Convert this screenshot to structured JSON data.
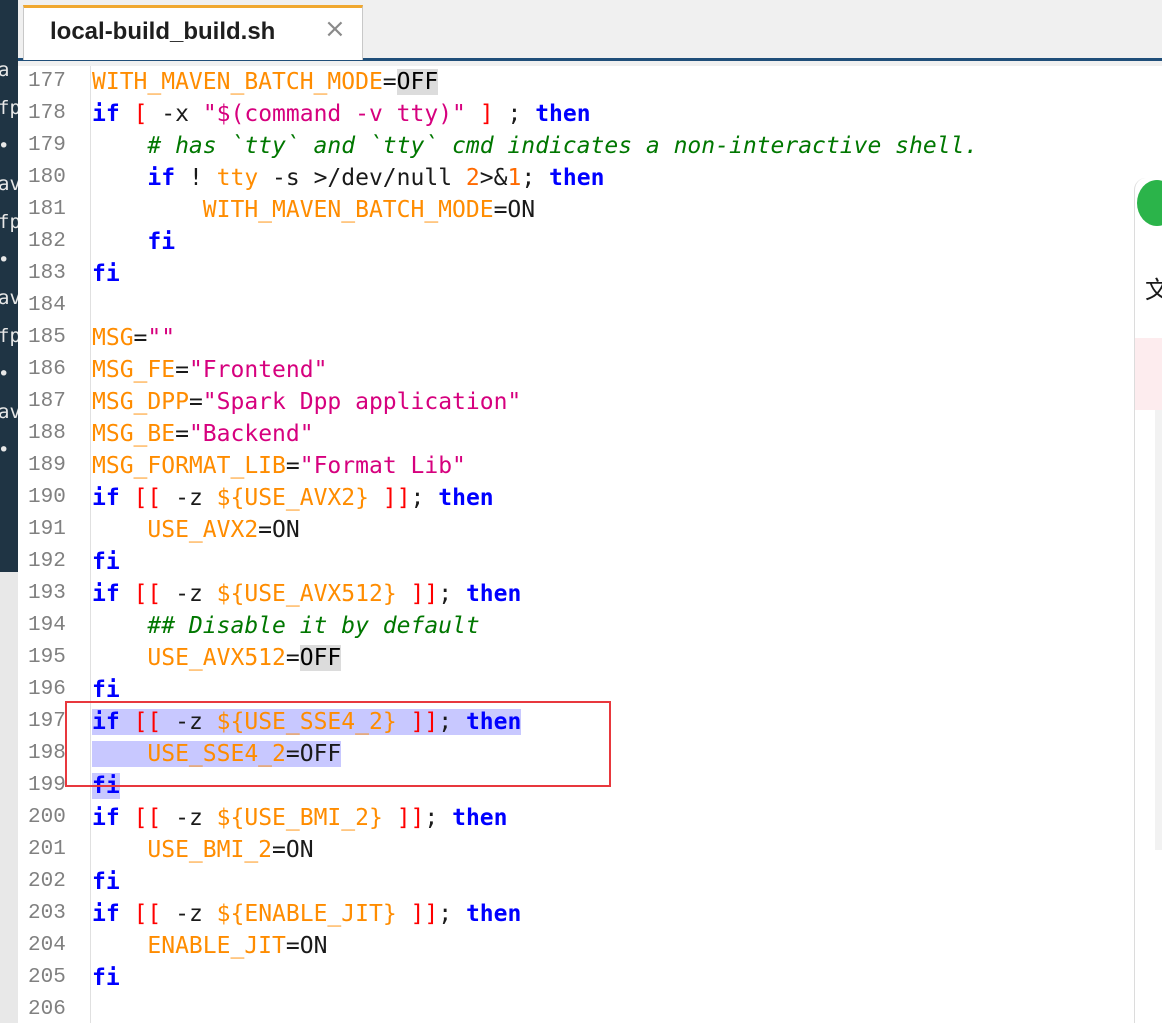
{
  "tab": {
    "title": "local-build_build.sh",
    "close_glyph": "×"
  },
  "left_terminal": [
    "a",
    "fp",
    "•",
    "av",
    "fp",
    "•",
    "av",
    "fp",
    "•",
    "av",
    "•"
  ],
  "right_panel": {
    "char": "文"
  },
  "lines": [
    {
      "n": "177",
      "parts": [
        [
          "var",
          "WITH_MAVEN_BATCH_MODE"
        ],
        [
          "op",
          "="
        ],
        [
          "sel",
          "OFF"
        ]
      ]
    },
    {
      "n": "178",
      "parts": [
        [
          "kw",
          "if"
        ],
        [
          "tx",
          " "
        ],
        [
          "brk",
          "["
        ],
        [
          "tx",
          " -x "
        ],
        [
          "str",
          "\"$(command -v tty)\""
        ],
        [
          "tx",
          " "
        ],
        [
          "brk",
          "]"
        ],
        [
          "tx",
          " ; "
        ],
        [
          "kw",
          "then"
        ]
      ]
    },
    {
      "n": "179",
      "parts": [
        [
          "tx",
          "    "
        ],
        [
          "cmt",
          "# has `tty` and `tty` cmd indicates a non-interactive shell."
        ]
      ]
    },
    {
      "n": "180",
      "parts": [
        [
          "tx",
          "    "
        ],
        [
          "kw",
          "if"
        ],
        [
          "tx",
          " ! "
        ],
        [
          "var",
          "tty"
        ],
        [
          "tx",
          " -s >/dev/null "
        ],
        [
          "num",
          "2"
        ],
        [
          "tx",
          ">&"
        ],
        [
          "num",
          "1"
        ],
        [
          "tx",
          "; "
        ],
        [
          "kw",
          "then"
        ]
      ]
    },
    {
      "n": "181",
      "parts": [
        [
          "tx",
          "        "
        ],
        [
          "var",
          "WITH_MAVEN_BATCH_MODE"
        ],
        [
          "op",
          "=ON"
        ]
      ]
    },
    {
      "n": "182",
      "parts": [
        [
          "tx",
          "    "
        ],
        [
          "kw",
          "fi"
        ]
      ]
    },
    {
      "n": "183",
      "parts": [
        [
          "kw",
          "fi"
        ]
      ]
    },
    {
      "n": "184",
      "parts": []
    },
    {
      "n": "185",
      "parts": [
        [
          "var",
          "MSG"
        ],
        [
          "op",
          "="
        ],
        [
          "str",
          "\"\""
        ]
      ]
    },
    {
      "n": "186",
      "parts": [
        [
          "var",
          "MSG_FE"
        ],
        [
          "op",
          "="
        ],
        [
          "str",
          "\"Frontend\""
        ]
      ]
    },
    {
      "n": "187",
      "parts": [
        [
          "var",
          "MSG_DPP"
        ],
        [
          "op",
          "="
        ],
        [
          "str",
          "\"Spark Dpp application\""
        ]
      ]
    },
    {
      "n": "188",
      "parts": [
        [
          "var",
          "MSG_BE"
        ],
        [
          "op",
          "="
        ],
        [
          "str",
          "\"Backend\""
        ]
      ]
    },
    {
      "n": "189",
      "parts": [
        [
          "var",
          "MSG_FORMAT_LIB"
        ],
        [
          "op",
          "="
        ],
        [
          "str",
          "\"Format Lib\""
        ]
      ]
    },
    {
      "n": "190",
      "parts": [
        [
          "kw",
          "if"
        ],
        [
          "tx",
          " "
        ],
        [
          "brk",
          "[["
        ],
        [
          "tx",
          " -z "
        ],
        [
          "var",
          "${USE_AVX2}"
        ],
        [
          "tx",
          " "
        ],
        [
          "brk",
          "]]"
        ],
        [
          "tx",
          "; "
        ],
        [
          "kw",
          "then"
        ]
      ]
    },
    {
      "n": "191",
      "parts": [
        [
          "tx",
          "    "
        ],
        [
          "var",
          "USE_AVX2"
        ],
        [
          "op",
          "=ON"
        ]
      ]
    },
    {
      "n": "192",
      "parts": [
        [
          "kw",
          "fi"
        ]
      ]
    },
    {
      "n": "193",
      "parts": [
        [
          "kw",
          "if"
        ],
        [
          "tx",
          " "
        ],
        [
          "brk",
          "[["
        ],
        [
          "tx",
          " -z "
        ],
        [
          "var",
          "${USE_AVX512}"
        ],
        [
          "tx",
          " "
        ],
        [
          "brk",
          "]]"
        ],
        [
          "tx",
          "; "
        ],
        [
          "kw",
          "then"
        ]
      ]
    },
    {
      "n": "194",
      "parts": [
        [
          "tx",
          "    "
        ],
        [
          "cmt",
          "## Disable it by default"
        ]
      ]
    },
    {
      "n": "195",
      "parts": [
        [
          "tx",
          "    "
        ],
        [
          "var",
          "USE_AVX512"
        ],
        [
          "op",
          "="
        ],
        [
          "sel",
          "OFF"
        ]
      ]
    },
    {
      "n": "196",
      "parts": [
        [
          "kw",
          "fi"
        ]
      ]
    },
    {
      "n": "197",
      "hl": true,
      "parts": [
        [
          "kw",
          "if"
        ],
        [
          "tx",
          " "
        ],
        [
          "brk",
          "[["
        ],
        [
          "tx",
          " -z "
        ],
        [
          "var",
          "${USE_SSE4_2}"
        ],
        [
          "tx",
          " "
        ],
        [
          "brk",
          "]]"
        ],
        [
          "tx",
          "; "
        ],
        [
          "kw",
          "then"
        ]
      ]
    },
    {
      "n": "198",
      "hl": true,
      "parts": [
        [
          "tx",
          "    "
        ],
        [
          "var",
          "USE_SSE4_2"
        ],
        [
          "op",
          "=OFF"
        ]
      ]
    },
    {
      "n": "199",
      "hl": true,
      "parts": [
        [
          "kw",
          "fi"
        ]
      ]
    },
    {
      "n": "200",
      "parts": [
        [
          "kw",
          "if"
        ],
        [
          "tx",
          " "
        ],
        [
          "brk",
          "[["
        ],
        [
          "tx",
          " -z "
        ],
        [
          "var",
          "${USE_BMI_2}"
        ],
        [
          "tx",
          " "
        ],
        [
          "brk",
          "]]"
        ],
        [
          "tx",
          "; "
        ],
        [
          "kw",
          "then"
        ]
      ]
    },
    {
      "n": "201",
      "parts": [
        [
          "tx",
          "    "
        ],
        [
          "var",
          "USE_BMI_2"
        ],
        [
          "op",
          "=ON"
        ]
      ]
    },
    {
      "n": "202",
      "parts": [
        [
          "kw",
          "fi"
        ]
      ]
    },
    {
      "n": "203",
      "parts": [
        [
          "kw",
          "if"
        ],
        [
          "tx",
          " "
        ],
        [
          "brk",
          "[["
        ],
        [
          "tx",
          " -z "
        ],
        [
          "var",
          "${ENABLE_JIT}"
        ],
        [
          "tx",
          " "
        ],
        [
          "brk",
          "]]"
        ],
        [
          "tx",
          "; "
        ],
        [
          "kw",
          "then"
        ]
      ]
    },
    {
      "n": "204",
      "parts": [
        [
          "tx",
          "    "
        ],
        [
          "var",
          "ENABLE_JIT"
        ],
        [
          "op",
          "=ON"
        ]
      ]
    },
    {
      "n": "205",
      "parts": [
        [
          "kw",
          "fi"
        ]
      ]
    },
    {
      "n": "206",
      "parts": []
    }
  ]
}
